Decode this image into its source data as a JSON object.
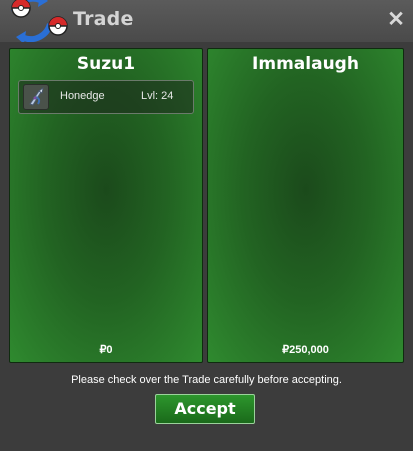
{
  "window": {
    "title": "Trade",
    "close_label": "✕"
  },
  "left_panel": {
    "player_name": "Suzu1",
    "items": [
      {
        "name": "Honedge",
        "level": "Lvl: 24",
        "icon": "sword-pokemon-icon"
      }
    ],
    "money": "₽0"
  },
  "right_panel": {
    "player_name": "Immalaugh",
    "items": [],
    "money": "₽250,000"
  },
  "notice": "Please check over the Trade carefully before accepting.",
  "accept_label": "Accept",
  "colors": {
    "panel_green": "#2f8a2f",
    "button_green": "#239023",
    "title_text": "#d4d4d4"
  }
}
